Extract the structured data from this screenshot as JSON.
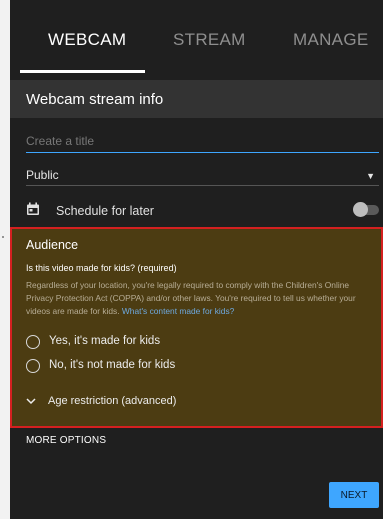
{
  "tabs": [
    "WEBCAM",
    "STREAM",
    "MANAGE"
  ],
  "header": {
    "title": "Webcam stream info"
  },
  "title_field": {
    "placeholder": "Create a title",
    "value": ""
  },
  "privacy": {
    "value": "Public"
  },
  "schedule": {
    "label": "Schedule for later",
    "enabled": false
  },
  "audience": {
    "title": "Audience",
    "question": "Is this video made for kids? (required)",
    "description": "Regardless of your location, you're legally required to comply with the Children's Online Privacy Protection Act (COPPA) and/or other laws. You're required to tell us whether your videos are made for kids.",
    "link": "What's content made for kids?",
    "options": [
      "Yes, it's made for kids",
      "No, it's not made for kids"
    ],
    "age_restriction": "Age restriction (advanced)"
  },
  "more_options": "MORE OPTIONS",
  "next_button": "NEXT",
  "colors": {
    "accent": "#3ea6ff",
    "audience_bg": "#4c3c12",
    "highlight_border": "#d42020"
  }
}
